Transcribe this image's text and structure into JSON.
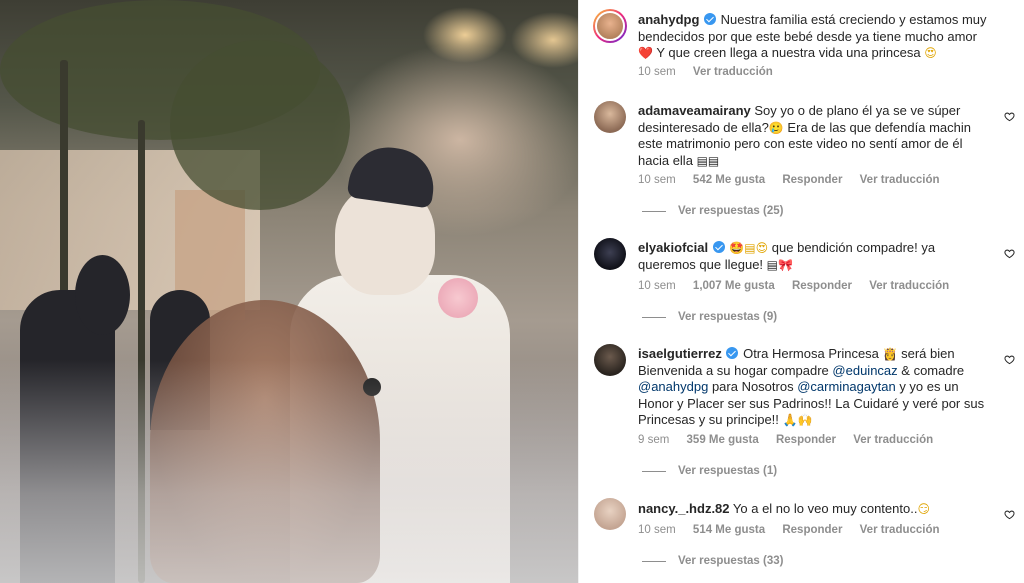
{
  "post": {
    "username": "anahydpg",
    "caption_1": "Nuestra familia está creciendo y estamos muy bendecidos por que este bebé desde ya tiene mucho amor",
    "caption_emoji_1": "❤️",
    "caption_2": "Y que creen llega a nuestra vida una princesa",
    "caption_emoji_2": "😍",
    "time": "10 sem",
    "translate": "Ver traducción"
  },
  "comments": [
    {
      "username": "adamaveamairany",
      "text": "Soy yo o de plano él ya se ve súper desinteresado de ella?",
      "emoji_a": "🥲",
      "text_b": "Era de las que defendía machin este matrimonio pero con este video no sentí amor de él hacia ella",
      "emoji_b": "▤▤",
      "time": "10 sem",
      "likes": "542 Me gusta",
      "reply": "Responder",
      "translate": "Ver traducción",
      "view_replies": "Ver respuestas (25)"
    },
    {
      "username": "elyakiofcial",
      "emoji_a": "🤩▤😍",
      "text": "que bendición compadre! ya queremos que llegue!",
      "emoji_b": "▤🎀",
      "time": "10 sem",
      "likes": "1,007 Me gusta",
      "reply": "Responder",
      "translate": "Ver traducción",
      "view_replies": "Ver respuestas (9)"
    },
    {
      "username": "isaelgutierrez",
      "text_a": "Otra Hermosa Princesa",
      "emoji_a": "👸",
      "text_b": "será bien Bienvenida a su hogar compadre",
      "mention_1": "@eduincaz",
      "text_c": "& comadre",
      "mention_2": "@anahydpg",
      "text_d": "para Nosotros",
      "mention_3": "@carminagaytan",
      "text_e": "y yo es un Honor y Placer ser sus Padrinos!! La Cuidaré y veré por sus Princesas y su principe!!",
      "emoji_b": "🙏🙌",
      "time": "9 sem",
      "likes": "359 Me gusta",
      "reply": "Responder",
      "translate": "Ver traducción",
      "view_replies": "Ver respuestas (1)"
    },
    {
      "username": "nancy._.hdz.82",
      "text": "Yo a el no lo veo muy contento..",
      "emoji_a": "😏",
      "time": "10 sem",
      "likes": "514 Me gusta",
      "reply": "Responder",
      "translate": "Ver traducción",
      "view_replies": "Ver respuestas (33)"
    }
  ],
  "icons": {
    "verified": "verified-badge-icon",
    "like": "heart-outline-icon"
  },
  "colors": {
    "text": "#262626",
    "muted": "#8e8e8e",
    "mention": "#00376b",
    "verified": "#3897f0"
  }
}
